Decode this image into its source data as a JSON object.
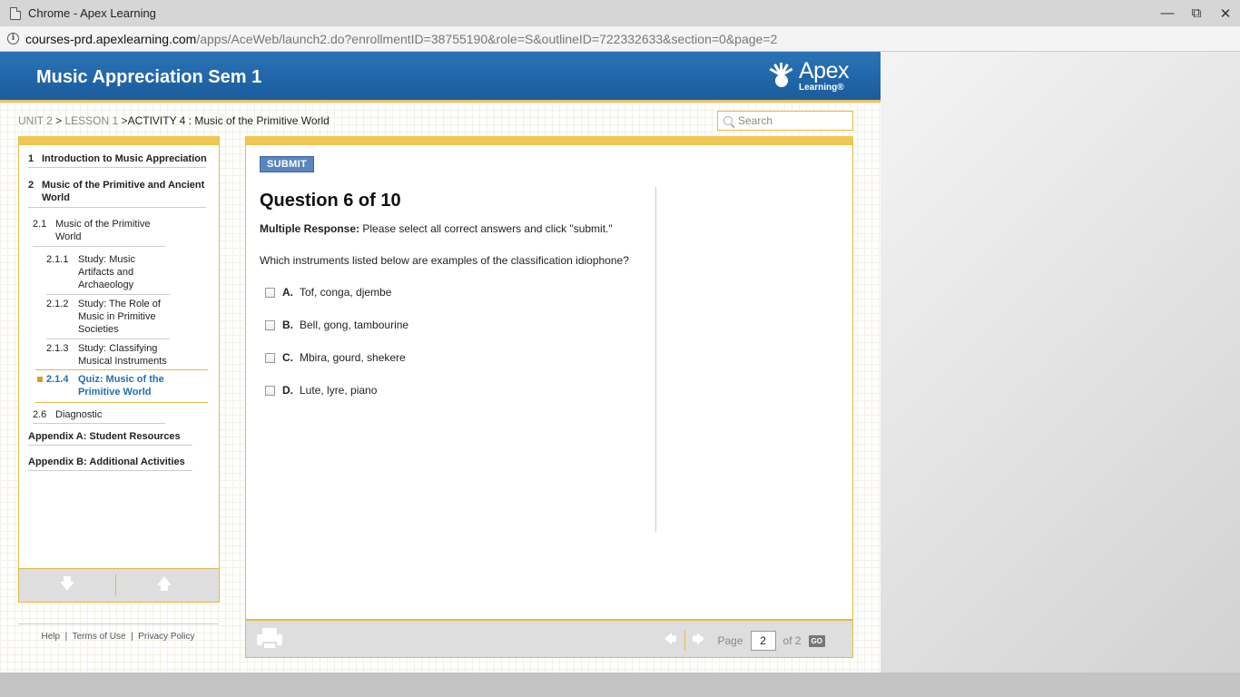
{
  "window": {
    "title": "Chrome - Apex Learning",
    "minimize": "—",
    "restore": "⧉",
    "close": "✕"
  },
  "address": {
    "host": "courses-prd.apexlearning.com",
    "path": "/apps/AceWeb/launch2.do?enrollmentID=38755190&role=S&outlineID=722332633&section=0&page=2"
  },
  "header": {
    "course_title": "Music Appreciation Sem 1",
    "logo_word": "Apex",
    "logo_sub": "Learning®"
  },
  "breadcrumb": {
    "unit": "UNIT 2",
    "lesson": "LESSON 1",
    "sep": ">",
    "activity": "ACTIVITY 4 : Music of the Primitive World"
  },
  "search": {
    "placeholder": "Search"
  },
  "sidebar": {
    "items": [
      {
        "num": "1",
        "label": "Introduction to Music Appreciation"
      },
      {
        "num": "2",
        "label": "Music of the Primitive and Ancient World"
      },
      {
        "num": "2.1",
        "label": "Music of the Primitive World"
      },
      {
        "num": "2.1.1",
        "label": "Study: Music Artifacts and Archaeology"
      },
      {
        "num": "2.1.2",
        "label": "Study: The Role of Music in Primitive Societies"
      },
      {
        "num": "2.1.3",
        "label": "Study: Classifying Musical Instruments"
      },
      {
        "num": "2.1.4",
        "label": "Quiz: Music of the Primitive World"
      },
      {
        "num": "2.6",
        "label": "Diagnostic"
      },
      {
        "num": "",
        "label": "Appendix A: Student Resources"
      },
      {
        "num": "",
        "label": "Appendix B: Additional Activities"
      }
    ],
    "down_arrow": "🡇",
    "up_arrow": "🡅"
  },
  "footer_links": {
    "help": "Help",
    "terms": "Terms of Use",
    "privacy": "Privacy Policy",
    "sep": "|"
  },
  "question": {
    "submit_label": "SUBMIT",
    "title": "Question 6 of 10",
    "type_label": "Multiple Response:",
    "instruction": "Please select all correct answers and click \"submit.\"",
    "prompt": "Which instruments listed below are examples of the classification idiophone?",
    "options": [
      {
        "letter": "A.",
        "text": "Tof, conga, djembe"
      },
      {
        "letter": "B.",
        "text": "Bell, gong, tambourine"
      },
      {
        "letter": "C.",
        "text": "Mbira, gourd, shekere"
      },
      {
        "letter": "D.",
        "text": "Lute, lyre, piano"
      }
    ]
  },
  "pager": {
    "page_label": "Page",
    "current_page": "2",
    "of_label": "of 2",
    "go_label": "GO",
    "prev_arrow": "🡄",
    "next_arrow": "🡆"
  }
}
